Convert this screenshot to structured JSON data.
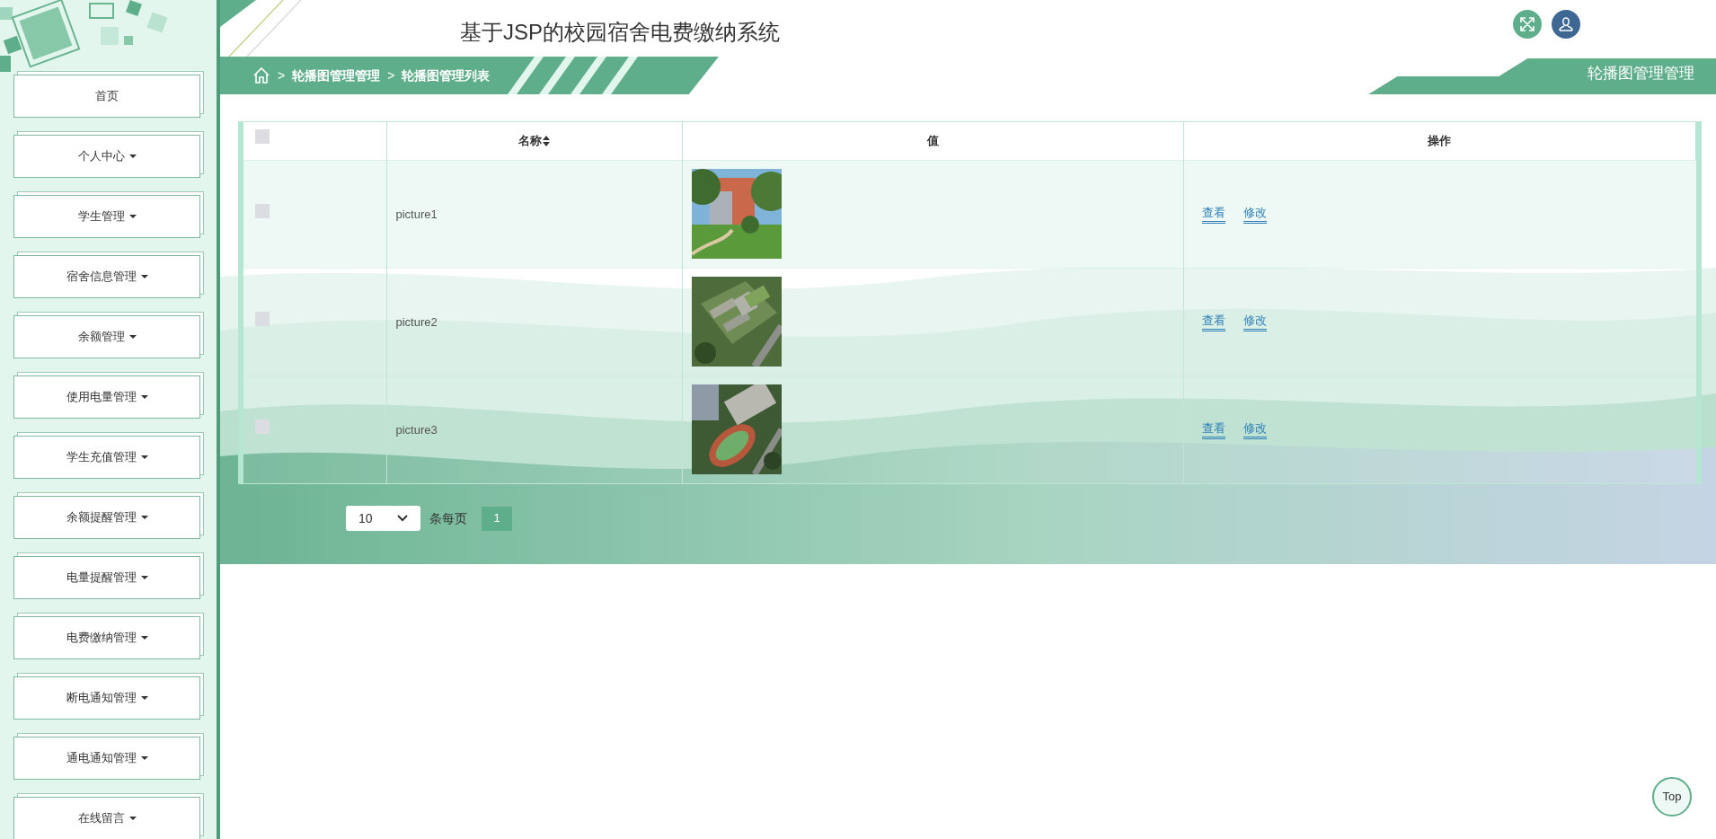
{
  "sidebar": {
    "items": [
      {
        "label": "首页",
        "dropdown": false
      },
      {
        "label": "个人中心",
        "dropdown": true
      },
      {
        "label": "学生管理",
        "dropdown": true
      },
      {
        "label": "宿舍信息管理",
        "dropdown": true
      },
      {
        "label": "余额管理",
        "dropdown": true
      },
      {
        "label": "使用电量管理",
        "dropdown": true
      },
      {
        "label": "学生充值管理",
        "dropdown": true
      },
      {
        "label": "余额提醒管理",
        "dropdown": true
      },
      {
        "label": "电量提醒管理",
        "dropdown": true
      },
      {
        "label": "电费缴纳管理",
        "dropdown": true
      },
      {
        "label": "断电通知管理",
        "dropdown": true
      },
      {
        "label": "通电通知管理",
        "dropdown": true
      },
      {
        "label": "在线留言",
        "dropdown": true
      }
    ]
  },
  "header": {
    "title": "基于JSP的校园宿舍电费缴纳系统"
  },
  "breadcrumb": [
    {
      "separator": ">",
      "label": "轮播图管理管理"
    },
    {
      "separator": ">",
      "label": "轮播图管理列表"
    }
  ],
  "page_title": "轮播图管理管理",
  "table": {
    "select_all": {
      "checked": false
    },
    "columns": [
      {
        "label": "名称",
        "sortable": true
      },
      {
        "label": "值",
        "sortable": false
      },
      {
        "label": "操作",
        "sortable": false
      }
    ],
    "rows": [
      {
        "checked": false,
        "name": "picture1",
        "value": {
          "kind": "picture"
        },
        "actions": [
          "查看",
          "修改"
        ]
      },
      {
        "checked": false,
        "name": "picture2",
        "value": {
          "kind": "picture"
        },
        "actions": [
          "查看",
          "修改"
        ]
      },
      {
        "checked": false,
        "name": "picture3",
        "value": {
          "kind": "picture"
        },
        "actions": [
          "查看",
          "修改"
        ]
      }
    ]
  },
  "pagination": {
    "page_size": "10",
    "per_page_label": "条每页",
    "pages": [
      {
        "label": "1",
        "selected": true
      }
    ]
  },
  "top_button": "Top"
}
